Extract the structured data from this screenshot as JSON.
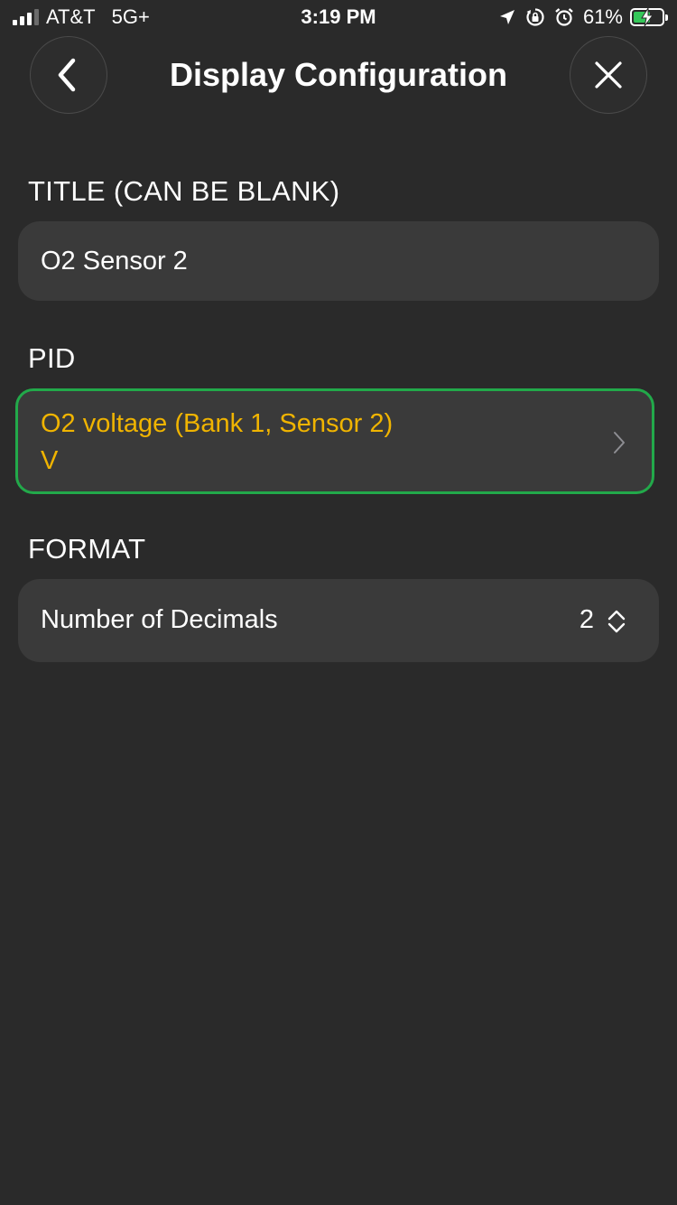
{
  "status_bar": {
    "carrier": "AT&T",
    "network": "5G+",
    "time": "3:19 PM",
    "battery_percent": "61%",
    "battery_level": 0.61,
    "icons": [
      "location-arrow-icon",
      "orientation-lock-icon",
      "alarm-icon",
      "battery-charging-icon"
    ]
  },
  "header": {
    "title": "Display Configuration",
    "back_icon": "chevron-left-icon",
    "close_icon": "close-icon"
  },
  "title_section": {
    "label": "TITLE (CAN BE BLANK)",
    "value": "O2 Sensor 2"
  },
  "pid_section": {
    "label": "PID",
    "name": "O2 voltage (Bank 1, Sensor 2)",
    "unit": "V",
    "accent_color": "#f0b400",
    "highlight_color": "#22a94a"
  },
  "format_section": {
    "label": "FORMAT",
    "decimals_label": "Number of Decimals",
    "decimals_value": "2"
  }
}
